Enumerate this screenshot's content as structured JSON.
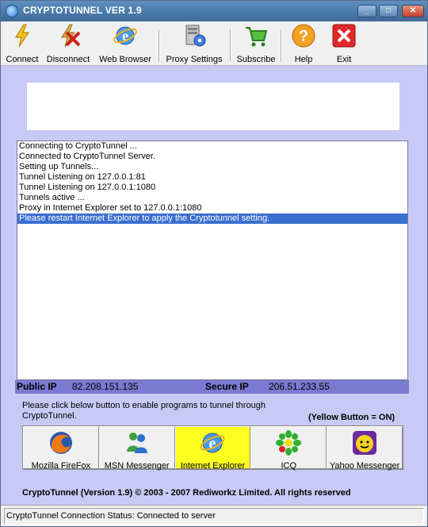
{
  "window": {
    "title": "CRYPTOTUNNEL VER 1.9"
  },
  "toolbar": {
    "connect": "Connect",
    "disconnect": "Disconnect",
    "web_browser": "Web Browser",
    "proxy_settings": "Proxy Settings",
    "subscribe": "Subscribe",
    "help": "Help",
    "exit": "Exit"
  },
  "log": {
    "lines": [
      "Connecting to CryptoTunnel ...",
      "Connected to CryptoTunnel Server.",
      "Setting up Tunnels...",
      "Tunnel Listening on 127.0.0.1:81",
      "Tunnel Listening on 127.0.0.1:1080",
      "Tunnels active ...",
      "Proxy in Internet Explorer set to 127.0.0.1:1080",
      "Please restart Internet Explorer to apply the Cryptotunnel setting."
    ]
  },
  "ip": {
    "public_label": "Public IP",
    "public_value": "82.208.151.135",
    "secure_label": "Secure IP",
    "secure_value": "206.51.233.55"
  },
  "instructions": "Please click below button to enable programs to tunnel through CryptoTunnel.",
  "legend": "(Yellow Button = ON)",
  "apps": [
    {
      "label": "Mozilla FireFox",
      "icon": "firefox-icon"
    },
    {
      "label": "MSN Messenger",
      "icon": "msn-icon"
    },
    {
      "label": "Internet Explorer",
      "icon": "ie-icon"
    },
    {
      "label": "ICQ",
      "icon": "icq-icon"
    },
    {
      "label": "Yahoo Messenger",
      "icon": "yahoo-icon"
    }
  ],
  "copyright": "CryptoTunnel (Version 1.9)  © 2003 - 2007 Rediworkz Limited. All rights reserved",
  "status": "CryptoTunnel Connection Status: Connected to server",
  "colors": {
    "active_app": "#ffff20",
    "selection": "#3a6fd0",
    "ipbar": "#7a7ad2"
  }
}
